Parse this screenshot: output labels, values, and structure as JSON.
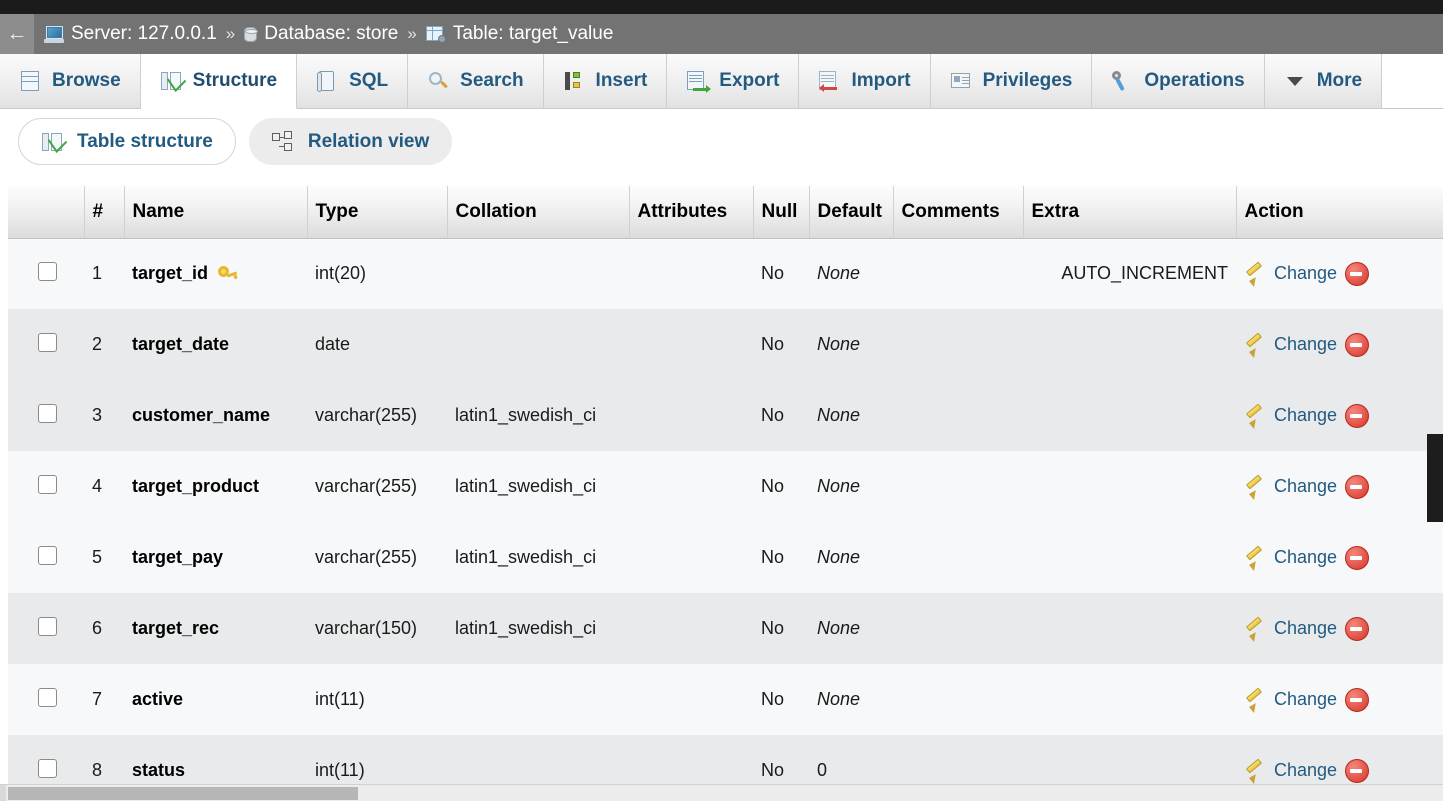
{
  "breadcrumb": {
    "back_label": "←",
    "server_icon": "server-icon",
    "server_label": "Server: 127.0.0.1",
    "sep1": "»",
    "database_icon": "database-icon",
    "database_label": "Database: store",
    "sep2": "»",
    "table_icon": "table-icon",
    "table_label": "Table: target_value"
  },
  "tabs": [
    {
      "label": "Browse",
      "icon": "browse-icon",
      "active": false
    },
    {
      "label": "Structure",
      "icon": "structure-icon",
      "active": true
    },
    {
      "label": "SQL",
      "icon": "sql-icon",
      "active": false
    },
    {
      "label": "Search",
      "icon": "search-icon",
      "active": false
    },
    {
      "label": "Insert",
      "icon": "insert-icon",
      "active": false
    },
    {
      "label": "Export",
      "icon": "export-icon",
      "active": false
    },
    {
      "label": "Import",
      "icon": "import-icon",
      "active": false
    },
    {
      "label": "Privileges",
      "icon": "privileges-icon",
      "active": false
    },
    {
      "label": "Operations",
      "icon": "operations-icon",
      "active": false
    },
    {
      "label": "More",
      "icon": "chevron-down-icon",
      "active": false
    }
  ],
  "subtabs": [
    {
      "label": "Table structure",
      "icon": "structure-icon",
      "active": true
    },
    {
      "label": "Relation view",
      "icon": "relation-icon",
      "active": false
    }
  ],
  "structure_table": {
    "headers": [
      "",
      "#",
      "Name",
      "Type",
      "Collation",
      "Attributes",
      "Null",
      "Default",
      "Comments",
      "Extra",
      "Action"
    ],
    "rows": [
      {
        "num": "1",
        "name": "target_id",
        "key": true,
        "type": "int(20)",
        "collation": "",
        "attributes": "",
        "null": "No",
        "default": "None",
        "default_italic": true,
        "comments": "",
        "extra": "AUTO_INCREMENT",
        "change_label": "Change",
        "drop_label": "Drop"
      },
      {
        "num": "2",
        "name": "target_date",
        "key": false,
        "type": "date",
        "collation": "",
        "attributes": "",
        "null": "No",
        "default": "None",
        "default_italic": true,
        "comments": "",
        "extra": "",
        "change_label": "Change",
        "drop_label": "Drop"
      },
      {
        "num": "3",
        "name": "customer_name",
        "key": false,
        "type": "varchar(255)",
        "collation": "latin1_swedish_ci",
        "attributes": "",
        "null": "No",
        "default": "None",
        "default_italic": true,
        "comments": "",
        "extra": "",
        "change_label": "Change",
        "drop_label": "Drop"
      },
      {
        "num": "4",
        "name": "target_product",
        "key": false,
        "type": "varchar(255)",
        "collation": "latin1_swedish_ci",
        "attributes": "",
        "null": "No",
        "default": "None",
        "default_italic": true,
        "comments": "",
        "extra": "",
        "change_label": "Change",
        "drop_label": "Drop"
      },
      {
        "num": "5",
        "name": "target_pay",
        "key": false,
        "type": "varchar(255)",
        "collation": "latin1_swedish_ci",
        "attributes": "",
        "null": "No",
        "default": "None",
        "default_italic": true,
        "comments": "",
        "extra": "",
        "change_label": "Change",
        "drop_label": "Drop"
      },
      {
        "num": "6",
        "name": "target_rec",
        "key": false,
        "type": "varchar(150)",
        "collation": "latin1_swedish_ci",
        "attributes": "",
        "null": "No",
        "default": "None",
        "default_italic": true,
        "comments": "",
        "extra": "",
        "change_label": "Change",
        "drop_label": "Drop"
      },
      {
        "num": "7",
        "name": "active",
        "key": false,
        "type": "int(11)",
        "collation": "",
        "attributes": "",
        "null": "No",
        "default": "None",
        "default_italic": true,
        "comments": "",
        "extra": "",
        "change_label": "Change",
        "drop_label": "Drop"
      },
      {
        "num": "8",
        "name": "status",
        "key": false,
        "type": "int(11)",
        "collation": "",
        "attributes": "",
        "null": "No",
        "default": "0",
        "default_italic": false,
        "comments": "",
        "extra": "",
        "change_label": "Change",
        "drop_label": "Drop"
      }
    ]
  },
  "colors": {
    "breadcrumb_bg": "#737373",
    "link_blue": "#235a81",
    "row_odd": "#f7f8f9",
    "row_even": "#e8eaeb",
    "key_gold": "#e7b82e",
    "drop_red": "#d8342a"
  }
}
